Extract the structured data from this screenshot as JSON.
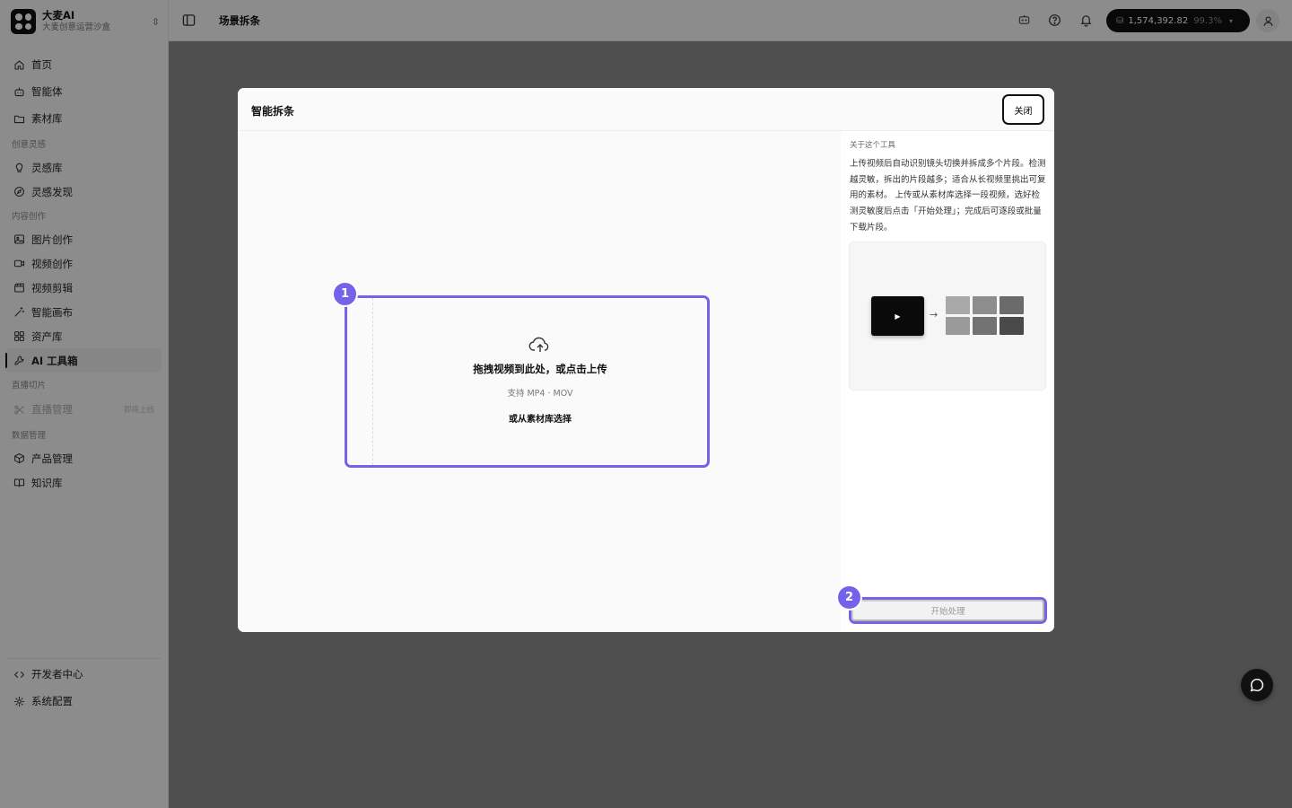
{
  "brand": {
    "name": "大麦AI",
    "subtitle": "大麦创意运营沙盒",
    "switch_icon": "chevron-updown-icon"
  },
  "sidebar": {
    "items_top": [
      {
        "label": "首页",
        "icon": "home-icon"
      },
      {
        "label": "智能体",
        "icon": "robot-icon"
      },
      {
        "label": "素材库",
        "icon": "folder-icon"
      }
    ],
    "section_inspiration": "创意灵感",
    "items_inspiration": [
      {
        "label": "灵感库",
        "icon": "lightbulb-icon"
      },
      {
        "label": "灵感发现",
        "icon": "compass-icon"
      }
    ],
    "section_creation": "内容创作",
    "items_creation": [
      {
        "label": "图片创作",
        "icon": "image-icon"
      },
      {
        "label": "视频创作",
        "icon": "video-icon"
      },
      {
        "label": "视频剪辑",
        "icon": "clapperboard-icon"
      },
      {
        "label": "智能画布",
        "icon": "magic-wand-icon"
      },
      {
        "label": "资产库",
        "icon": "grid-icon"
      },
      {
        "label": "AI 工具箱",
        "icon": "wrench-icon",
        "active": true
      }
    ],
    "section_live": "直播切片",
    "items_live": [
      {
        "label": "直播管理",
        "icon": "scissors-icon",
        "disabled": true,
        "tag": "即将上线"
      }
    ],
    "section_data": "数据管理",
    "items_data": [
      {
        "label": "产品管理",
        "icon": "box-icon"
      },
      {
        "label": "知识库",
        "icon": "book-icon"
      }
    ],
    "items_bottom": [
      {
        "label": "开发者中心",
        "icon": "code-icon"
      },
      {
        "label": "系统配置",
        "icon": "gear-icon"
      }
    ]
  },
  "topbar": {
    "breadcrumb": "场景拆条",
    "credits": "1,574,392.82",
    "credits_pct": "99.3%"
  },
  "modal": {
    "title": "智能拆条",
    "close_label": "关闭",
    "upload": {
      "title": "拖拽视频到此处，或点击上传",
      "hint": "支持 MP4 · MOV",
      "library_link": "或从素材库选择",
      "step": "1"
    },
    "about": {
      "label": "关于这个工具",
      "description": "上传视频后自动识别镜头切换并拆成多个片段。检测越灵敏，拆出的片段越多；适合从长视频里挑出可复用的素材。 上传或从素材库选择一段视频，选好检测灵敏度后点击「开始处理」；完成后可逐段或批量下载片段。"
    },
    "start_label": "开始处理",
    "start_step": "2"
  },
  "colors": {
    "accent": "#7263ea",
    "dark": "#111111",
    "overlay": "rgba(0,0,0,0.43)"
  },
  "preview_tiles": [
    "#a9a9a9",
    "#8d8d8d",
    "#6b6b6b",
    "#9a9a9a",
    "#727272",
    "#4a4a4a"
  ]
}
